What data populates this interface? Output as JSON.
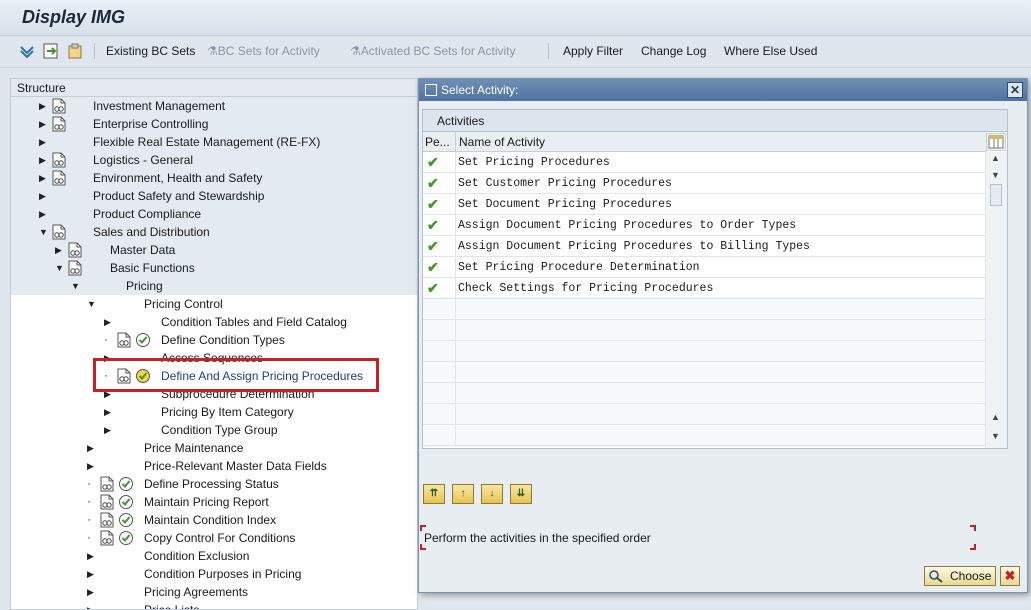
{
  "window": {
    "title": "Display IMG"
  },
  "toolbar": {
    "existing_bc_sets": "Existing BC Sets",
    "bc_sets_for_activity": "BC Sets for Activity",
    "activated_bc_sets": "Activated BC Sets for Activity",
    "apply_filter": "Apply Filter",
    "change_log": "Change Log",
    "where_else_used": "Where Else Used"
  },
  "tree": {
    "header": "Structure",
    "nodes": [
      {
        "label": "Investment Management"
      },
      {
        "label": "Enterprise Controlling"
      },
      {
        "label": "Flexible Real Estate Management (RE-FX)"
      },
      {
        "label": "Logistics - General"
      },
      {
        "label": "Environment, Health and Safety"
      },
      {
        "label": "Product Safety and Stewardship"
      },
      {
        "label": "Product Compliance"
      },
      {
        "label": "Sales and Distribution"
      },
      {
        "label": "Master Data"
      },
      {
        "label": "Basic Functions"
      },
      {
        "label": "Pricing"
      },
      {
        "label": "Pricing Control"
      },
      {
        "label": "Condition Tables and Field Catalog"
      },
      {
        "label": "Define Condition Types"
      },
      {
        "label": "Access Sequences"
      },
      {
        "label": "Define And Assign Pricing Procedures"
      },
      {
        "label": "Subprocedure Determination"
      },
      {
        "label": "Pricing By Item Category"
      },
      {
        "label": "Condition Type Group"
      },
      {
        "label": "Price Maintenance"
      },
      {
        "label": "Price-Relevant Master Data Fields"
      },
      {
        "label": "Define Processing Status"
      },
      {
        "label": "Maintain Pricing Report"
      },
      {
        "label": "Maintain Condition Index"
      },
      {
        "label": "Copy Control For Conditions"
      },
      {
        "label": "Condition Exclusion"
      },
      {
        "label": "Condition Purposes in Pricing"
      },
      {
        "label": "Pricing Agreements"
      },
      {
        "label": "Price Lists"
      }
    ]
  },
  "dialog": {
    "title": "Select Activity:",
    "grid_caption": "Activities",
    "col_performed": "Pe...",
    "col_name": "Name of Activity",
    "activities": [
      {
        "name": "Set Pricing Procedures"
      },
      {
        "name": "Set Customer Pricing Procedures"
      },
      {
        "name": "Set Document Pricing Procedures"
      },
      {
        "name": "Assign Document Pricing Procedures to Order Types"
      },
      {
        "name": "Assign Document Pricing Procedures to Billing Types"
      },
      {
        "name": "Set Pricing Procedure Determination"
      },
      {
        "name": "Check Settings for Pricing Procedures"
      }
    ],
    "instruction": "Perform the activities in the specified order",
    "choose_label": "Choose",
    "accent_color": "#c8202b",
    "check_color": "#3c9a2a"
  }
}
